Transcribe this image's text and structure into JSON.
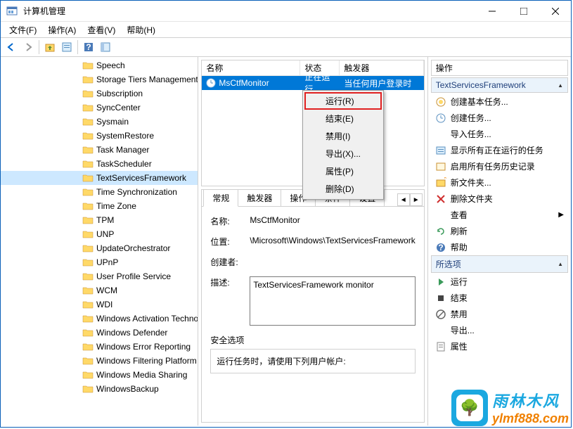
{
  "window": {
    "title": "计算机管理"
  },
  "menu": {
    "file": "文件(F)",
    "action": "操作(A)",
    "view": "查看(V)",
    "help": "帮助(H)"
  },
  "tree_items": [
    {
      "label": "Speech",
      "selected": false
    },
    {
      "label": "Storage Tiers Management",
      "selected": false
    },
    {
      "label": "Subscription",
      "selected": false
    },
    {
      "label": "SyncCenter",
      "selected": false
    },
    {
      "label": "Sysmain",
      "selected": false
    },
    {
      "label": "SystemRestore",
      "selected": false
    },
    {
      "label": "Task Manager",
      "selected": false
    },
    {
      "label": "TaskScheduler",
      "selected": false
    },
    {
      "label": "TextServicesFramework",
      "selected": true
    },
    {
      "label": "Time Synchronization",
      "selected": false
    },
    {
      "label": "Time Zone",
      "selected": false
    },
    {
      "label": "TPM",
      "selected": false
    },
    {
      "label": "UNP",
      "selected": false
    },
    {
      "label": "UpdateOrchestrator",
      "selected": false
    },
    {
      "label": "UPnP",
      "selected": false
    },
    {
      "label": "User Profile Service",
      "selected": false
    },
    {
      "label": "WCM",
      "selected": false
    },
    {
      "label": "WDI",
      "selected": false
    },
    {
      "label": "Windows Activation Technologies",
      "selected": false
    },
    {
      "label": "Windows Defender",
      "selected": false
    },
    {
      "label": "Windows Error Reporting",
      "selected": false
    },
    {
      "label": "Windows Filtering Platform",
      "selected": false
    },
    {
      "label": "Windows Media Sharing",
      "selected": false
    },
    {
      "label": "WindowsBackup",
      "selected": false
    }
  ],
  "task_list": {
    "col_name": "名称",
    "col_status": "状态",
    "col_trigger": "触发器",
    "row_name": "MsCtfMonitor",
    "row_status": "正在运行",
    "row_trigger": "当任何用户登录时"
  },
  "context_menu": {
    "run": "运行(R)",
    "end": "结束(E)",
    "disable": "禁用(I)",
    "export": "导出(X)...",
    "properties": "属性(P)",
    "delete": "删除(D)"
  },
  "detail": {
    "tab_general": "常规",
    "tab_triggers": "触发器",
    "tab_actions": "操作",
    "tab_conditions": "条件",
    "tab_settings": "设置",
    "lbl_name": "名称:",
    "val_name": "MsCtfMonitor",
    "lbl_location": "位置:",
    "val_location": "\\Microsoft\\Windows\\TextServicesFramework",
    "lbl_creator": "创建者:",
    "val_creator": "",
    "lbl_description": "描述:",
    "val_description": "TextServicesFramework monitor",
    "lbl_security": "安全选项",
    "lbl_runwhen": "运行任务时，请使用下列用户帐户:"
  },
  "actions": {
    "title": "操作",
    "section1": "TextServicesFramework",
    "create_basic": "创建基本任务...",
    "create_task": "创建任务...",
    "import": "导入任务...",
    "show_running": "显示所有正在运行的任务",
    "enable_history": "启用所有任务历史记录",
    "new_folder": "新文件夹...",
    "delete_folder": "删除文件夹",
    "view": "查看",
    "refresh": "刷新",
    "help": "帮助",
    "section2": "所选项",
    "run": "运行",
    "end": "结束",
    "disable": "禁用",
    "export": "导出...",
    "properties": "属性"
  },
  "watermark": {
    "line1": "雨林木风",
    "line2": "ylmf888.com"
  }
}
